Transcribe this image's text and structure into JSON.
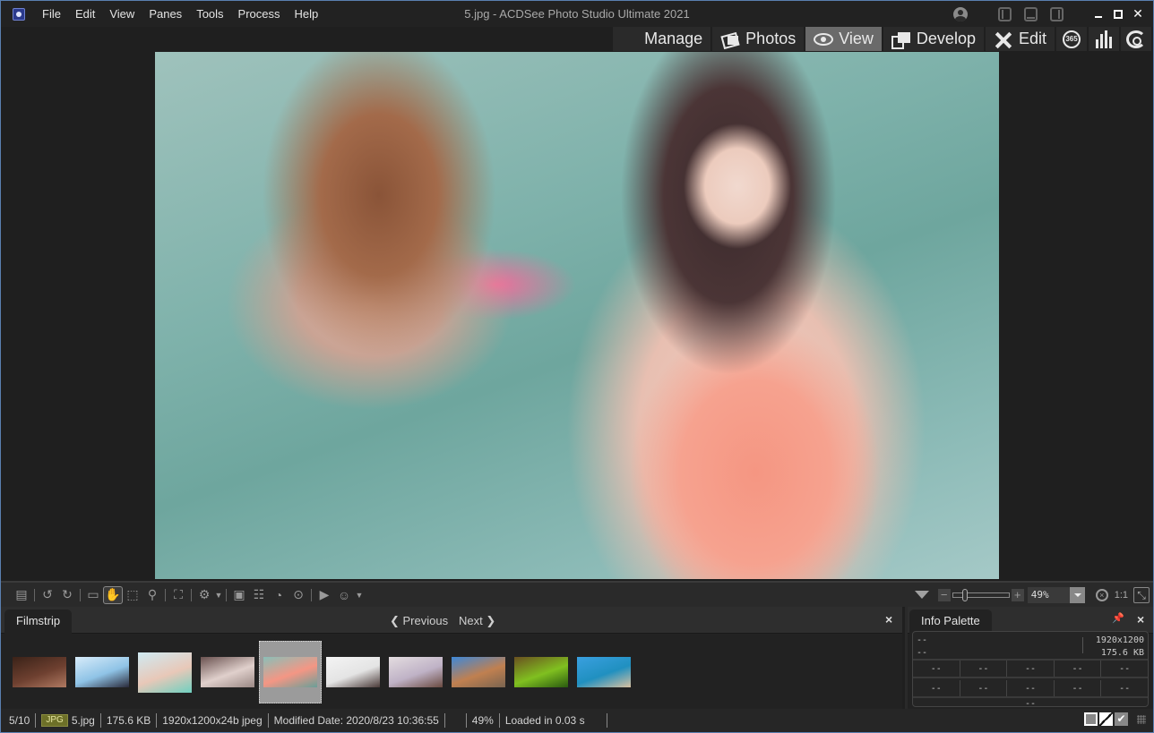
{
  "window": {
    "title": "5.jpg - ACDSee Photo Studio Ultimate 2021"
  },
  "menu": {
    "items": [
      "File",
      "Edit",
      "View",
      "Panes",
      "Tools",
      "Process",
      "Help"
    ]
  },
  "modes": {
    "tabs": [
      {
        "label": "Manage",
        "icon": "grid-icon",
        "active": false
      },
      {
        "label": "Photos",
        "icon": "photos-icon",
        "active": false
      },
      {
        "label": "View",
        "icon": "eye-icon",
        "active": true
      },
      {
        "label": "Develop",
        "icon": "develop-icon",
        "active": false
      },
      {
        "label": "Edit",
        "icon": "edit-tools-icon",
        "active": false
      }
    ],
    "icon_tabs": [
      {
        "name": "365",
        "label": "365"
      },
      {
        "name": "dashboard",
        "icon": "bar-chart-icon"
      },
      {
        "name": "live",
        "icon": "live-icon"
      }
    ]
  },
  "viewer": {
    "image_name": "5.jpg"
  },
  "toolbar": {
    "zoom_value": "49%",
    "actual_size_label": "1:1"
  },
  "filmstrip": {
    "tab_label": "Filmstrip",
    "previous_label": "Previous",
    "next_label": "Next",
    "close_label": "×",
    "thumbnails": [
      {
        "colors": [
          "#3a2218",
          "#6e4030",
          "#b07a62"
        ],
        "selected": false,
        "tall": false
      },
      {
        "colors": [
          "#d8ecfa",
          "#8fc3e6",
          "#2a2a3a"
        ],
        "selected": false,
        "tall": false
      },
      {
        "colors": [
          "#cfeaf2",
          "#e8c8b8",
          "#6fd0c0"
        ],
        "selected": false,
        "tall": true
      },
      {
        "colors": [
          "#6a5250",
          "#e0d0cc",
          "#9a8884"
        ],
        "selected": false,
        "tall": false
      },
      {
        "colors": [
          "#8abfb8",
          "#f49684",
          "#6a9f98"
        ],
        "selected": true,
        "tall": false
      },
      {
        "colors": [
          "#f4f4f4",
          "#e4e4e4",
          "#4a3a38"
        ],
        "selected": false,
        "tall": false
      },
      {
        "colors": [
          "#e4dde0",
          "#bfb2c6",
          "#6a4a40"
        ],
        "selected": false,
        "tall": false
      },
      {
        "colors": [
          "#3e88d8",
          "#c08050",
          "#7a6450"
        ],
        "selected": false,
        "tall": false
      },
      {
        "colors": [
          "#6a5020",
          "#80c020",
          "#2a5a10"
        ],
        "selected": false,
        "tall": false
      },
      {
        "colors": [
          "#3aa0e0",
          "#2090c0",
          "#d8c0a0"
        ],
        "selected": false,
        "tall": false
      }
    ]
  },
  "info_palette": {
    "tab_label": "Info Palette",
    "left_line1": "--",
    "left_line2": "--",
    "dimensions": "1920x1200",
    "file_size": "175.6 KB",
    "row1": [
      "--",
      "--",
      "--",
      "--",
      "--"
    ],
    "row2": [
      "--",
      "--",
      "--",
      "--",
      "--"
    ],
    "bottom": "--",
    "close_label": "×"
  },
  "status": {
    "position": "5/10",
    "format_badge": "JPG",
    "filename": "5.jpg",
    "filesize": "175.6 KB",
    "image_info": "1920x1200x24b jpeg",
    "modified": "Modified Date: 2020/8/23 10:36:55",
    "zoom": "49%",
    "load_time": "Loaded in 0.03 s"
  },
  "colors": {
    "accent_active_tab": "#6a6a6a",
    "badge": "#6d7028",
    "background": "#1f1f1f"
  }
}
